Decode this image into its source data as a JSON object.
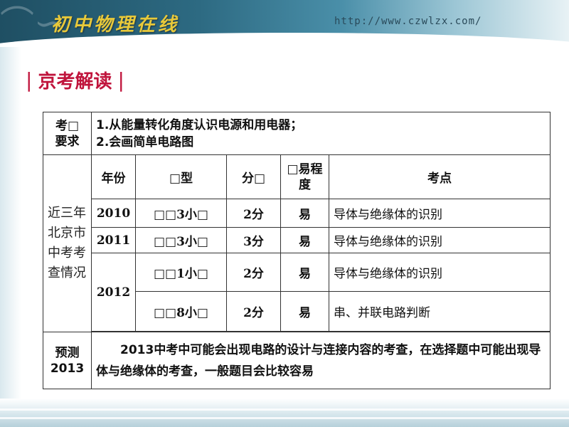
{
  "banner": {
    "logo": "初中物理在线",
    "url": "http://www.czwlzx.com/"
  },
  "section_title": "京考解读",
  "table": {
    "requirement_label": "考□\n要求",
    "requirement_lines": [
      "1.从能量转化角度认识电源和用电器；",
      "2.会画简单电路图"
    ],
    "history_label": "近三年北京市中考考查情况",
    "headers": {
      "year": "年份",
      "type": "□型",
      "score": "分□",
      "difficulty": "□易程度",
      "point": "考点"
    },
    "rows": [
      {
        "year": "2010",
        "type": "□□3小□",
        "score": "2分",
        "difficulty": "易",
        "point": "导体与绝缘体的识别"
      },
      {
        "year": "2011",
        "type": "□□3小□",
        "score": "3分",
        "difficulty": "易",
        "point": "导体与绝缘体的识别"
      },
      {
        "year": "2012",
        "type": "□□1小□",
        "score": "2分",
        "difficulty": "易",
        "point": "导体与绝缘体的识别"
      },
      {
        "year": "",
        "type": "□□8小□",
        "score": "2分",
        "difficulty": "易",
        "point": "串、并联电路判断"
      }
    ],
    "prediction_label": "预测\n2013",
    "prediction_text": "2013中考中可能会出现电路的设计与连接内容的考查，在选择题中可能出现导体与绝缘体的考查，一般题目会比较容易"
  }
}
